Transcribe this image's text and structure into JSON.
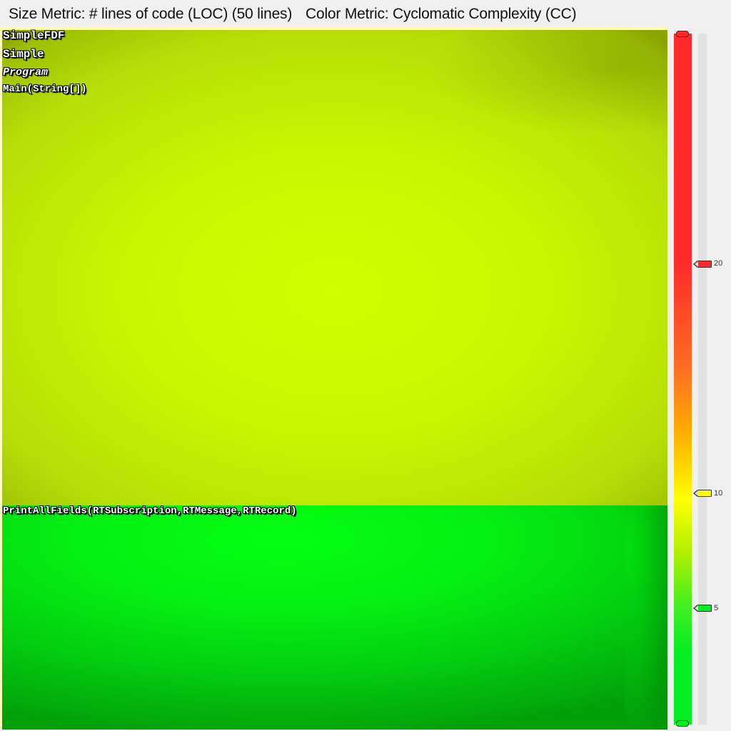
{
  "header": {
    "size_metric": "Size Metric: # lines of code (LOC) (50 lines)",
    "color_metric": "Color Metric: Cyclomatic Complexity (CC)"
  },
  "treemap": {
    "labels": {
      "namespace_root": "SimpleFDF",
      "namespace": "Simple",
      "class": "Program",
      "method_main": "Main(String[])",
      "method_print": "PrintAllFields(RTSubscription,RTMessage,RTRecord)"
    },
    "colors": {
      "main_method": "#c8f800",
      "print_method": "#04f012",
      "print_sliver": "#02b00c"
    }
  },
  "legend": {
    "ticks": [
      "20",
      "10",
      "5"
    ],
    "colors": {
      "high": "#ff2a2a",
      "mid": "#ffff00",
      "low": "#00ee22"
    },
    "markers": {
      "top_color": "#ff2a2a",
      "twenty_color": "#ff2a2a",
      "ten_color": "#ffff00",
      "five_color": "#00ee22",
      "bottom_color": "#00ee22"
    }
  }
}
